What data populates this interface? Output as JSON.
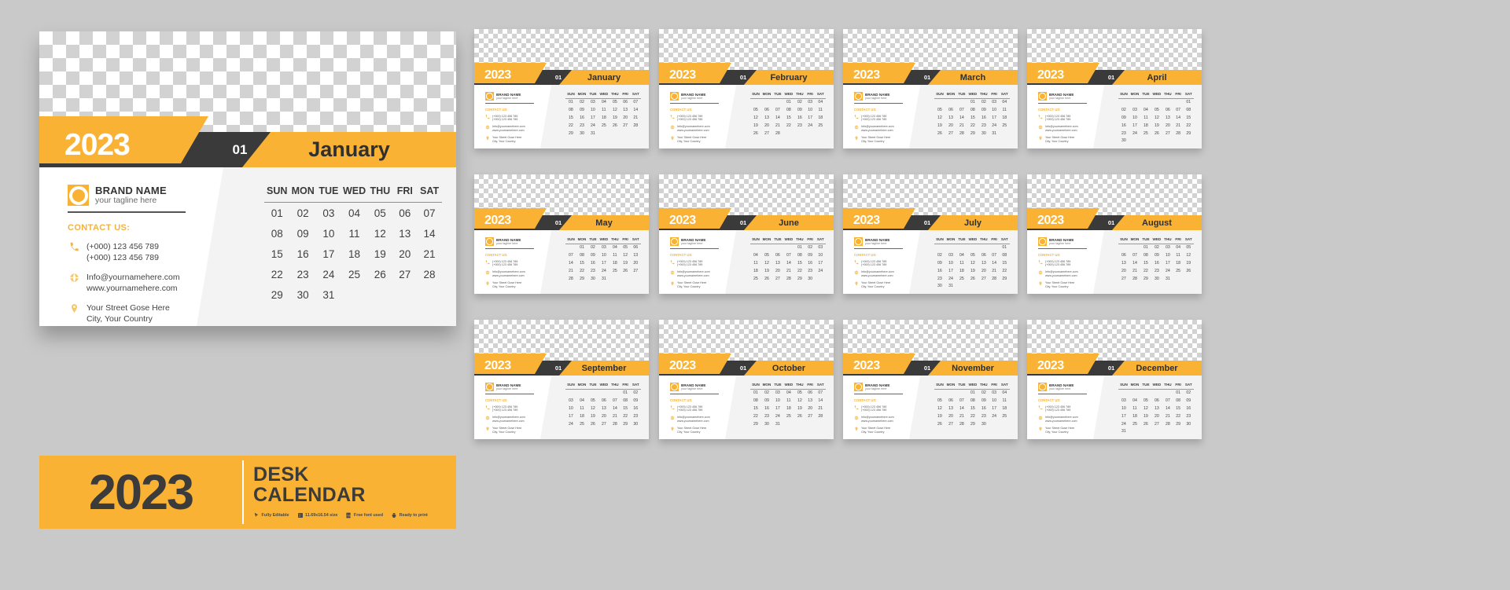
{
  "brand": {
    "name": "BRAND NAME",
    "tagline": "your tagline here",
    "contact_heading": "CONTACT US:",
    "phone1": "(+000) 123 456 789",
    "phone2": "(+000) 123 456 789",
    "email": "Info@yournamehere.com",
    "website": "www.yournamehere.com",
    "street": "Your  Street Gose Here",
    "city": "City, Your Country"
  },
  "main_card": {
    "year": "2023",
    "month_number": "01",
    "month_name": "January",
    "weekdays": [
      "SUN",
      "MON",
      "TUE",
      "WED",
      "THU",
      "FRI",
      "SAT"
    ]
  },
  "banner": {
    "year": "2023",
    "title_line1": "DESK",
    "title_line2": "CALENDAR",
    "features": [
      {
        "icon": "cursor-icon",
        "label": "Fully Editable"
      },
      {
        "icon": "ruler-icon",
        "label": "11.69x16.54 size"
      },
      {
        "icon": "font-icon",
        "label": "Free font used"
      },
      {
        "icon": "printer-icon",
        "label": "Ready to print"
      }
    ]
  },
  "colors": {
    "accent": "#f9b233",
    "dark": "#3a3a3a",
    "page_bg": "#c9c9c9",
    "card_bg": "#ffffff",
    "grey_panel": "#f3f3f3"
  },
  "calendar": {
    "year": "2023",
    "weekdays": [
      "SUN",
      "MON",
      "TUE",
      "WED",
      "THU",
      "FRI",
      "SAT"
    ],
    "months": [
      {
        "number": "01",
        "name": "January",
        "weeks": [
          [
            "01",
            "02",
            "03",
            "04",
            "05",
            "06",
            "07"
          ],
          [
            "08",
            "09",
            "10",
            "11",
            "12",
            "13",
            "14"
          ],
          [
            "15",
            "16",
            "17",
            "18",
            "19",
            "20",
            "21"
          ],
          [
            "22",
            "23",
            "24",
            "25",
            "26",
            "27",
            "28"
          ],
          [
            "29",
            "30",
            "31",
            "",
            "",
            "",
            ""
          ]
        ]
      },
      {
        "number": "01",
        "name": "February",
        "weeks": [
          [
            "",
            "",
            "",
            "01",
            "02",
            "03",
            "04"
          ],
          [
            "05",
            "06",
            "07",
            "08",
            "09",
            "10",
            "11"
          ],
          [
            "12",
            "13",
            "14",
            "15",
            "16",
            "17",
            "18"
          ],
          [
            "19",
            "20",
            "21",
            "22",
            "23",
            "24",
            "25"
          ],
          [
            "26",
            "27",
            "28",
            "",
            "",
            "",
            ""
          ]
        ]
      },
      {
        "number": "01",
        "name": "March",
        "weeks": [
          [
            "",
            "",
            "",
            "01",
            "02",
            "03",
            "04"
          ],
          [
            "05",
            "06",
            "07",
            "08",
            "09",
            "10",
            "11"
          ],
          [
            "12",
            "13",
            "14",
            "15",
            "16",
            "17",
            "18"
          ],
          [
            "19",
            "20",
            "21",
            "22",
            "23",
            "24",
            "25"
          ],
          [
            "26",
            "27",
            "28",
            "29",
            "30",
            "31",
            ""
          ]
        ]
      },
      {
        "number": "01",
        "name": "April",
        "weeks": [
          [
            "",
            "",
            "",
            "",
            "",
            "",
            "01"
          ],
          [
            "02",
            "03",
            "04",
            "05",
            "06",
            "07",
            "08"
          ],
          [
            "09",
            "10",
            "11",
            "12",
            "13",
            "14",
            "15"
          ],
          [
            "16",
            "17",
            "18",
            "19",
            "20",
            "21",
            "22"
          ],
          [
            "23",
            "24",
            "25",
            "26",
            "27",
            "28",
            "29"
          ],
          [
            "30",
            "",
            "",
            "",
            "",
            "",
            ""
          ]
        ]
      },
      {
        "number": "01",
        "name": "May",
        "weeks": [
          [
            "",
            "01",
            "02",
            "03",
            "04",
            "05",
            "06"
          ],
          [
            "07",
            "08",
            "09",
            "10",
            "11",
            "12",
            "13"
          ],
          [
            "14",
            "15",
            "16",
            "17",
            "18",
            "19",
            "20"
          ],
          [
            "21",
            "22",
            "23",
            "24",
            "25",
            "26",
            "27"
          ],
          [
            "28",
            "29",
            "30",
            "31",
            "",
            "",
            ""
          ]
        ]
      },
      {
        "number": "01",
        "name": "June",
        "weeks": [
          [
            "",
            "",
            "",
            "",
            "01",
            "02",
            "03"
          ],
          [
            "04",
            "05",
            "06",
            "07",
            "08",
            "09",
            "10"
          ],
          [
            "11",
            "12",
            "13",
            "14",
            "15",
            "16",
            "17"
          ],
          [
            "18",
            "19",
            "20",
            "21",
            "22",
            "23",
            "24"
          ],
          [
            "25",
            "26",
            "27",
            "28",
            "29",
            "30",
            ""
          ]
        ]
      },
      {
        "number": "01",
        "name": "July",
        "weeks": [
          [
            "",
            "",
            "",
            "",
            "",
            "",
            "01"
          ],
          [
            "02",
            "03",
            "04",
            "05",
            "06",
            "07",
            "08"
          ],
          [
            "09",
            "10",
            "11",
            "12",
            "13",
            "14",
            "15"
          ],
          [
            "16",
            "17",
            "18",
            "19",
            "20",
            "21",
            "22"
          ],
          [
            "23",
            "24",
            "25",
            "26",
            "27",
            "28",
            "29"
          ],
          [
            "30",
            "31",
            "",
            "",
            "",
            "",
            ""
          ]
        ]
      },
      {
        "number": "01",
        "name": "August",
        "weeks": [
          [
            "",
            "",
            "01",
            "02",
            "03",
            "04",
            "05"
          ],
          [
            "06",
            "07",
            "08",
            "09",
            "10",
            "11",
            "12"
          ],
          [
            "13",
            "14",
            "15",
            "16",
            "17",
            "18",
            "19"
          ],
          [
            "20",
            "21",
            "22",
            "23",
            "24",
            "25",
            "26"
          ],
          [
            "27",
            "28",
            "29",
            "30",
            "31",
            "",
            ""
          ]
        ]
      },
      {
        "number": "01",
        "name": "September",
        "weeks": [
          [
            "",
            "",
            "",
            "",
            "",
            "01",
            "02"
          ],
          [
            "03",
            "04",
            "05",
            "06",
            "07",
            "08",
            "09"
          ],
          [
            "10",
            "11",
            "12",
            "13",
            "14",
            "15",
            "16"
          ],
          [
            "17",
            "18",
            "19",
            "20",
            "21",
            "22",
            "23"
          ],
          [
            "24",
            "25",
            "26",
            "27",
            "28",
            "29",
            "30"
          ]
        ]
      },
      {
        "number": "01",
        "name": "October",
        "weeks": [
          [
            "01",
            "02",
            "03",
            "04",
            "05",
            "06",
            "07"
          ],
          [
            "08",
            "09",
            "10",
            "11",
            "12",
            "13",
            "14"
          ],
          [
            "15",
            "16",
            "17",
            "18",
            "19",
            "20",
            "21"
          ],
          [
            "22",
            "23",
            "24",
            "25",
            "26",
            "27",
            "28"
          ],
          [
            "29",
            "30",
            "31",
            "",
            "",
            "",
            ""
          ]
        ]
      },
      {
        "number": "01",
        "name": "November",
        "weeks": [
          [
            "",
            "",
            "",
            "01",
            "02",
            "03",
            "04"
          ],
          [
            "05",
            "06",
            "07",
            "08",
            "09",
            "10",
            "11"
          ],
          [
            "12",
            "13",
            "14",
            "15",
            "16",
            "17",
            "18"
          ],
          [
            "19",
            "20",
            "21",
            "22",
            "23",
            "24",
            "25"
          ],
          [
            "26",
            "27",
            "28",
            "29",
            "30",
            "",
            ""
          ]
        ]
      },
      {
        "number": "01",
        "name": "December",
        "weeks": [
          [
            "",
            "",
            "",
            "",
            "",
            "01",
            "02"
          ],
          [
            "03",
            "04",
            "05",
            "06",
            "07",
            "08",
            "09"
          ],
          [
            "10",
            "11",
            "12",
            "13",
            "14",
            "15",
            "16"
          ],
          [
            "17",
            "18",
            "19",
            "20",
            "21",
            "22",
            "23"
          ],
          [
            "24",
            "25",
            "26",
            "27",
            "28",
            "29",
            "30"
          ],
          [
            "31",
            "",
            "",
            "",
            "",
            "",
            ""
          ]
        ]
      }
    ]
  }
}
